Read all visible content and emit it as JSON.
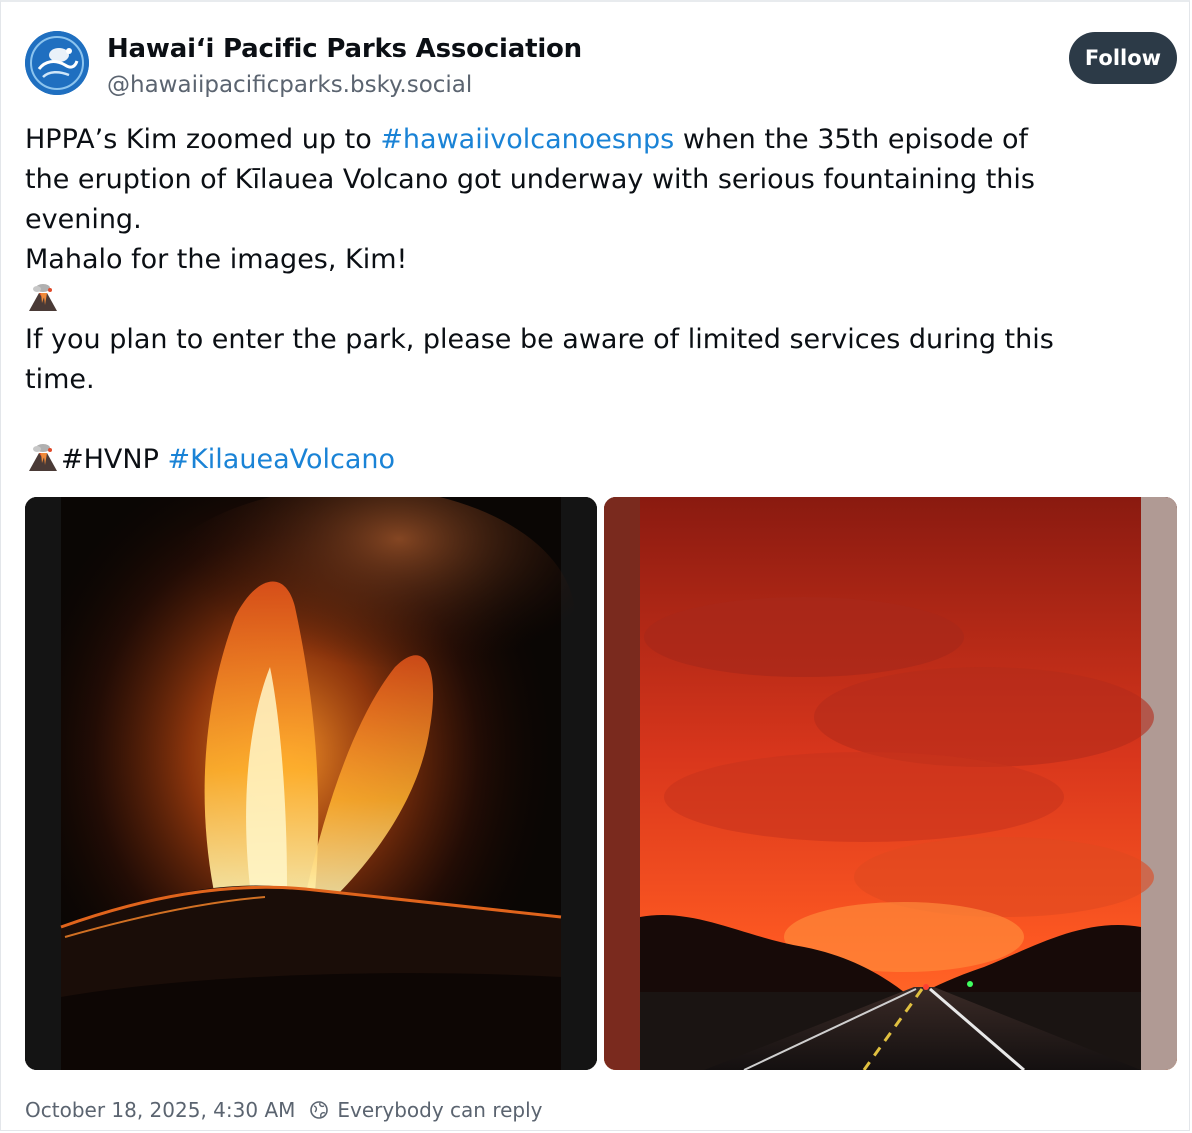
{
  "author": {
    "display_name": "Hawaiʻi Pacific Parks Association",
    "handle": "@hawaiipacificparks.bsky.social"
  },
  "follow_label": "Follow",
  "post": {
    "line1_before": "HPPA’s Kim zoomed up to ",
    "line1_hashtag": "#hawaiivolcanoesnps",
    "line1_after": " when the 35th episode of",
    "line2": "the eruption of Kīlauea Volcano got underway with serious fountaining this",
    "line3": "evening.",
    "line4": "Mahalo for the images, Kim!",
    "line6": " If you plan to enter the park, please be aware of limited services during this",
    "line7": "time.",
    "tag_plain": "#HVNP",
    "tag_link": "#KilaueaVolcano"
  },
  "media": [
    {
      "icon": "volcano-eruption-photo"
    },
    {
      "icon": "red-sky-road-photo"
    }
  ],
  "footer": {
    "timestamp": "October 18, 2025, 4:30 AM",
    "reply_setting": "Everybody can reply"
  }
}
